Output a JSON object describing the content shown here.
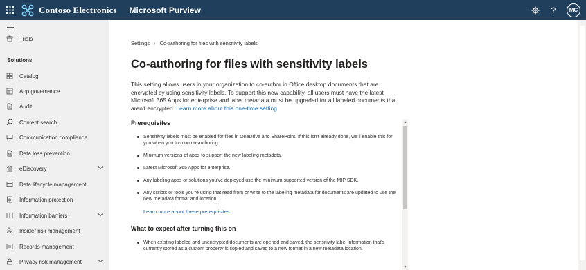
{
  "header": {
    "brand": "Contoso Electronics",
    "app": "Microsoft Purview",
    "avatar": "MC",
    "help": "?"
  },
  "sidebar": {
    "section_label": "Solutions",
    "trials": "Trials",
    "items": [
      {
        "label": "Catalog",
        "icon": "catalog-icon"
      },
      {
        "label": "App governance",
        "icon": "app-governance-icon"
      },
      {
        "label": "Audit",
        "icon": "audit-icon"
      },
      {
        "label": "Content search",
        "icon": "search-icon"
      },
      {
        "label": "Communication compliance",
        "icon": "communication-icon"
      },
      {
        "label": "Data loss prevention",
        "icon": "shield-icon"
      },
      {
        "label": "eDiscovery",
        "icon": "ediscovery-icon",
        "expandable": true
      },
      {
        "label": "Data lifecycle management",
        "icon": "lifecycle-icon"
      },
      {
        "label": "Information protection",
        "icon": "lock-icon"
      },
      {
        "label": "Information barriers",
        "icon": "barrier-icon",
        "expandable": true
      },
      {
        "label": "Insider risk management",
        "icon": "insider-risk-icon"
      },
      {
        "label": "Records management",
        "icon": "records-icon"
      },
      {
        "label": "Privacy risk management",
        "icon": "privacy-icon",
        "expandable": true
      }
    ]
  },
  "main": {
    "breadcrumb": [
      "Settings",
      "Co-authoring for files with sensitivity labels"
    ],
    "title": "Co-authoring for files with sensitivity labels",
    "intro": "This setting allows users in your organization to co-author in Office desktop documents that are encrypted by using sensitivity labels. To support this new capability, all users must have the latest Microsoft 365 Apps for enterprise and label metadata must be upgraded for all labeled documents that aren't encrypted.",
    "intro_link": "Learn more about this one-time setting",
    "prereq_title": "Prerequisites",
    "prereqs": [
      "Sensitivity labels must be enabled for files in OneDrive and SharePoint. If this isn't already done, we'll enable this for you when you turn on co-authoring.",
      "Minimum versions of apps to support the new labeling metadata.",
      "Latest Microsoft 365 Apps for enterprise.",
      "Any labeling apps or solutions you've deployed use the minimum supported version of the MIP SDK.",
      "Any scripts or tools you're using that read from or write to the labeling metadata for documents are updated to use the new metadata format and location."
    ],
    "prereq_link": "Learn more about these prerequisites",
    "expect_title": "What to expect after turning this on",
    "expect": [
      "When existing labeled and unencrypted documents are opened and saved, the sensitivity label information that's currently stored as a custom property is copied and saved to a new format in a new metadata location."
    ]
  }
}
